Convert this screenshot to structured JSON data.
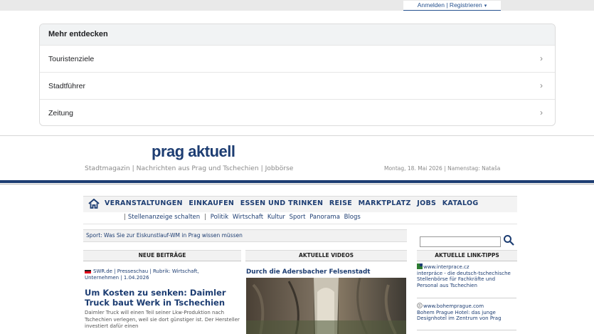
{
  "account": {
    "login_label": "Anmelden | Registrieren",
    "caret_icon": "caret-down-icon"
  },
  "discover": {
    "heading": "Mehr entdecken",
    "items": [
      {
        "label": "Touristenziele"
      },
      {
        "label": "Stadtführer"
      },
      {
        "label": "Zeitung"
      }
    ],
    "chevron": "›"
  },
  "masthead": {
    "brand": "prag aktuell",
    "tagline": "Stadtmagazin | Nachrichten aus Prag und Tschechien | Jobbörse",
    "dateline": "Montag, 18. Mai 2026 | Namenstag: Nataša"
  },
  "nav": {
    "home_icon": "home-icon",
    "items": [
      "VERANSTALTUNGEN",
      "EINKAUFEN",
      "ESSEN UND TRINKEN",
      "REISE",
      "MARKTPLATZ",
      "JOBS",
      "KATALOG"
    ]
  },
  "subnav": {
    "lead": "Stellenanzeige schalten",
    "items": [
      "Politik",
      "Wirtschaft",
      "Kultur",
      "Sport",
      "Panorama",
      "Blogs"
    ]
  },
  "ticker": "Sport: Was Sie zur Eiskunstlauf-WM in Prag wissen müssen",
  "columns": {
    "news": "NEUE BEITRÄGE",
    "videos": "AKTUELLE VIDEOS",
    "links": "AKTUELLE LINK-TIPPS"
  },
  "article": {
    "meta": "SWR.de | Presseschau | Rubrik: Wirtschaft, Unternehmen | 1.04.2026",
    "title": "Um Kosten zu senken: Daimler Truck baut Werk in Tschechien",
    "teaser": "Daimler Truck will einen Teil seiner Lkw-Produktion nach Tschechien verlegen, weil sie dort günstiger ist. Der Hersteller investiert dafür einen"
  },
  "video": {
    "title": "Durch die Adersbacher Felsenstadt"
  },
  "search": {
    "placeholder": "",
    "icon": "search-icon"
  },
  "link_tips": [
    {
      "url": "www.interprace.cz",
      "text": "interpráce - die deutsch-tschechische Stellenbörse für Fachkräfte und Personal aus Tschechien"
    },
    {
      "url": "www.bohemprague.com",
      "text": "Bohem Prague Hotel: das junge Designhotel im Zentrum von Prag"
    }
  ],
  "colors": {
    "brand_blue": "#1d3d72",
    "link_blue": "#27528f",
    "muted_grey": "#8a8a8a"
  }
}
